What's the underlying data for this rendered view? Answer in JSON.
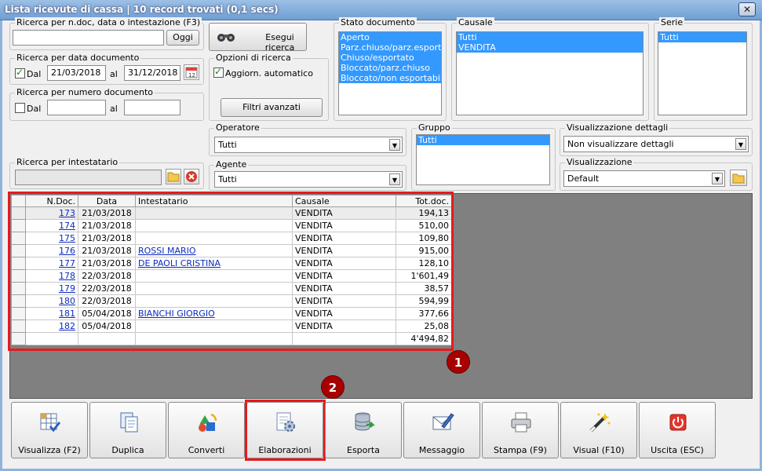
{
  "window": {
    "title": "Lista ricevute di cassa | 10 record trovati (0,1 secs)",
    "close_glyph": "✕"
  },
  "search_text": {
    "legend": "Ricerca per n.doc, data o intestazione (F3)",
    "value": "",
    "button": "Oggi"
  },
  "search_button": "Esegui ricerca",
  "by_date": {
    "legend": "Ricerca per data documento",
    "checkbox_label": "Dal",
    "checked": true,
    "from": "21/03/2018",
    "to_label": "al",
    "to": "31/12/2018"
  },
  "by_number": {
    "legend": "Ricerca per numero documento",
    "checkbox_label": "Dal",
    "checked": false,
    "from": "",
    "to_label": "al",
    "to": ""
  },
  "options": {
    "legend": "Opzioni di ricerca",
    "auto_update_label": "Aggiorn. automatico",
    "auto_update": true,
    "advanced_filters": "Filtri avanzati"
  },
  "stato": {
    "legend": "Stato documento",
    "items": [
      "Aperto",
      "Parz.chiuso/parz.esportato",
      "Chiuso/esportato",
      "Bloccato/parz.chiuso",
      "Bloccato/non esportabile"
    ]
  },
  "causale": {
    "legend": "Causale",
    "items": [
      "Tutti",
      "VENDITA"
    ]
  },
  "serie": {
    "legend": "Serie",
    "items": [
      "Tutti"
    ]
  },
  "operatore": {
    "legend": "Operatore",
    "value": "Tutti"
  },
  "agente": {
    "legend": "Agente",
    "value": "Tutti"
  },
  "gruppo": {
    "legend": "Gruppo",
    "items": [
      "Tutti"
    ]
  },
  "dettagli": {
    "legend": "Visualizzazione dettagli",
    "value": "Non visualizzare dettagli"
  },
  "visualizzazione": {
    "legend": "Visualizzazione",
    "value": "Default"
  },
  "intestatario": {
    "legend": "Ricerca per intestatario",
    "value": ""
  },
  "table": {
    "columns": [
      "N.Doc.",
      "Data",
      "Intestatario",
      "Causale",
      "Tot.doc."
    ],
    "rows": [
      {
        "ndoc": "173",
        "data": "21/03/2018",
        "intestatario": "",
        "causale": "VENDITA",
        "tot": "194,13"
      },
      {
        "ndoc": "174",
        "data": "21/03/2018",
        "intestatario": "",
        "causale": "VENDITA",
        "tot": "510,00"
      },
      {
        "ndoc": "175",
        "data": "21/03/2018",
        "intestatario": "",
        "causale": "VENDITA",
        "tot": "109,80"
      },
      {
        "ndoc": "176",
        "data": "21/03/2018",
        "intestatario": "ROSSI MARIO",
        "causale": "VENDITA",
        "tot": "915,00"
      },
      {
        "ndoc": "177",
        "data": "21/03/2018",
        "intestatario": "DE PAOLI CRISTINA",
        "causale": "VENDITA",
        "tot": "128,10"
      },
      {
        "ndoc": "178",
        "data": "22/03/2018",
        "intestatario": "",
        "causale": "VENDITA",
        "tot": "1'601,49"
      },
      {
        "ndoc": "179",
        "data": "22/03/2018",
        "intestatario": "",
        "causale": "VENDITA",
        "tot": "38,57"
      },
      {
        "ndoc": "180",
        "data": "22/03/2018",
        "intestatario": "",
        "causale": "VENDITA",
        "tot": "594,99"
      },
      {
        "ndoc": "181",
        "data": "05/04/2018",
        "intestatario": "BIANCHI GIORGIO",
        "causale": "VENDITA",
        "tot": "377,66"
      },
      {
        "ndoc": "182",
        "data": "05/04/2018",
        "intestatario": "",
        "causale": "VENDITA",
        "tot": "25,08"
      }
    ],
    "total": "4'494,82"
  },
  "callouts": {
    "one": "1",
    "two": "2",
    "color": "#e8191d"
  },
  "toolbar": [
    {
      "label": "Visualizza (F2)",
      "icon": "grid-check-icon"
    },
    {
      "label": "Duplica",
      "icon": "duplicate-icon"
    },
    {
      "label": "Converti",
      "icon": "convert-icon"
    },
    {
      "label": "Elaborazioni",
      "icon": "processing-icon"
    },
    {
      "label": "Esporta",
      "icon": "database-export-icon"
    },
    {
      "label": "Messaggio",
      "icon": "envelope-pen-icon"
    },
    {
      "label": "Stampa (F9)",
      "icon": "printer-icon"
    },
    {
      "label": "Visual (F10)",
      "icon": "magic-wand-icon"
    },
    {
      "label": "Uscita (ESC)",
      "icon": "power-icon"
    }
  ]
}
